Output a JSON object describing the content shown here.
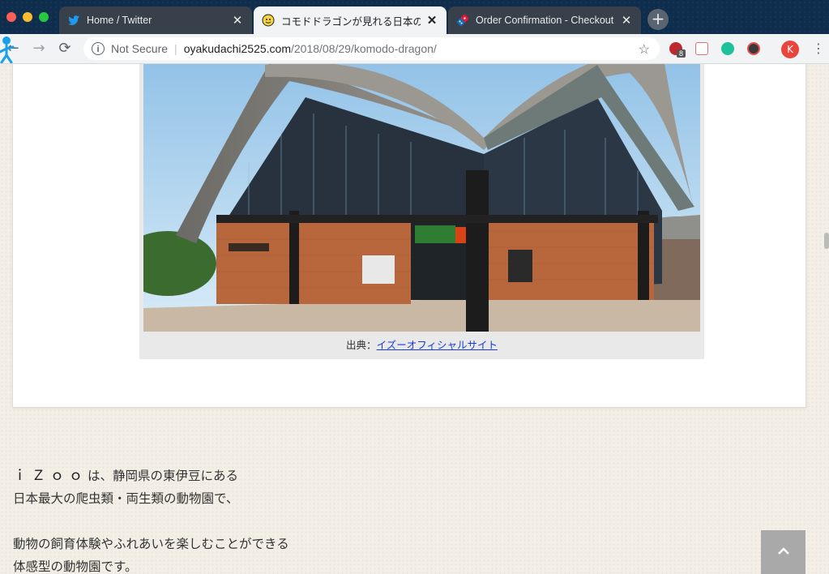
{
  "tabs": [
    {
      "title": "Home / Twitter",
      "icon": "twitter-bird-icon",
      "state": "inactive"
    },
    {
      "title": "コモドドラゴンが見れる日本の動物",
      "icon": "yellow-face-icon",
      "state": "active"
    },
    {
      "title": "Order Confirmation - Checkout C",
      "icon": "dominos-icon",
      "state": "inactive"
    }
  ],
  "toolbar": {
    "security_label": "Not Secure",
    "url_host": "oyakudachi2525.com",
    "url_path": "/2018/08/29/komodo-dragon/",
    "extension_badge": "8",
    "profile_initial": "K"
  },
  "figure": {
    "caption_prefix": "出典：",
    "caption_link": "イズーオフィシャルサイト"
  },
  "article": {
    "para1_line1_izoo": "ｉＺｏｏ",
    "para1_line1_rest": "は、静岡県の東伊豆にある",
    "para1_line2": "日本最大の爬虫類・両生類の動物園で、",
    "para2_line1": "動物の飼育体験やふれあいを楽しむことができる",
    "para2_line2": "体感型の動物園です。"
  },
  "colors": {
    "tabbar": "#0f2d4c",
    "link": "#1a3dd1",
    "scroll_top_button": "#a9a9a9"
  }
}
